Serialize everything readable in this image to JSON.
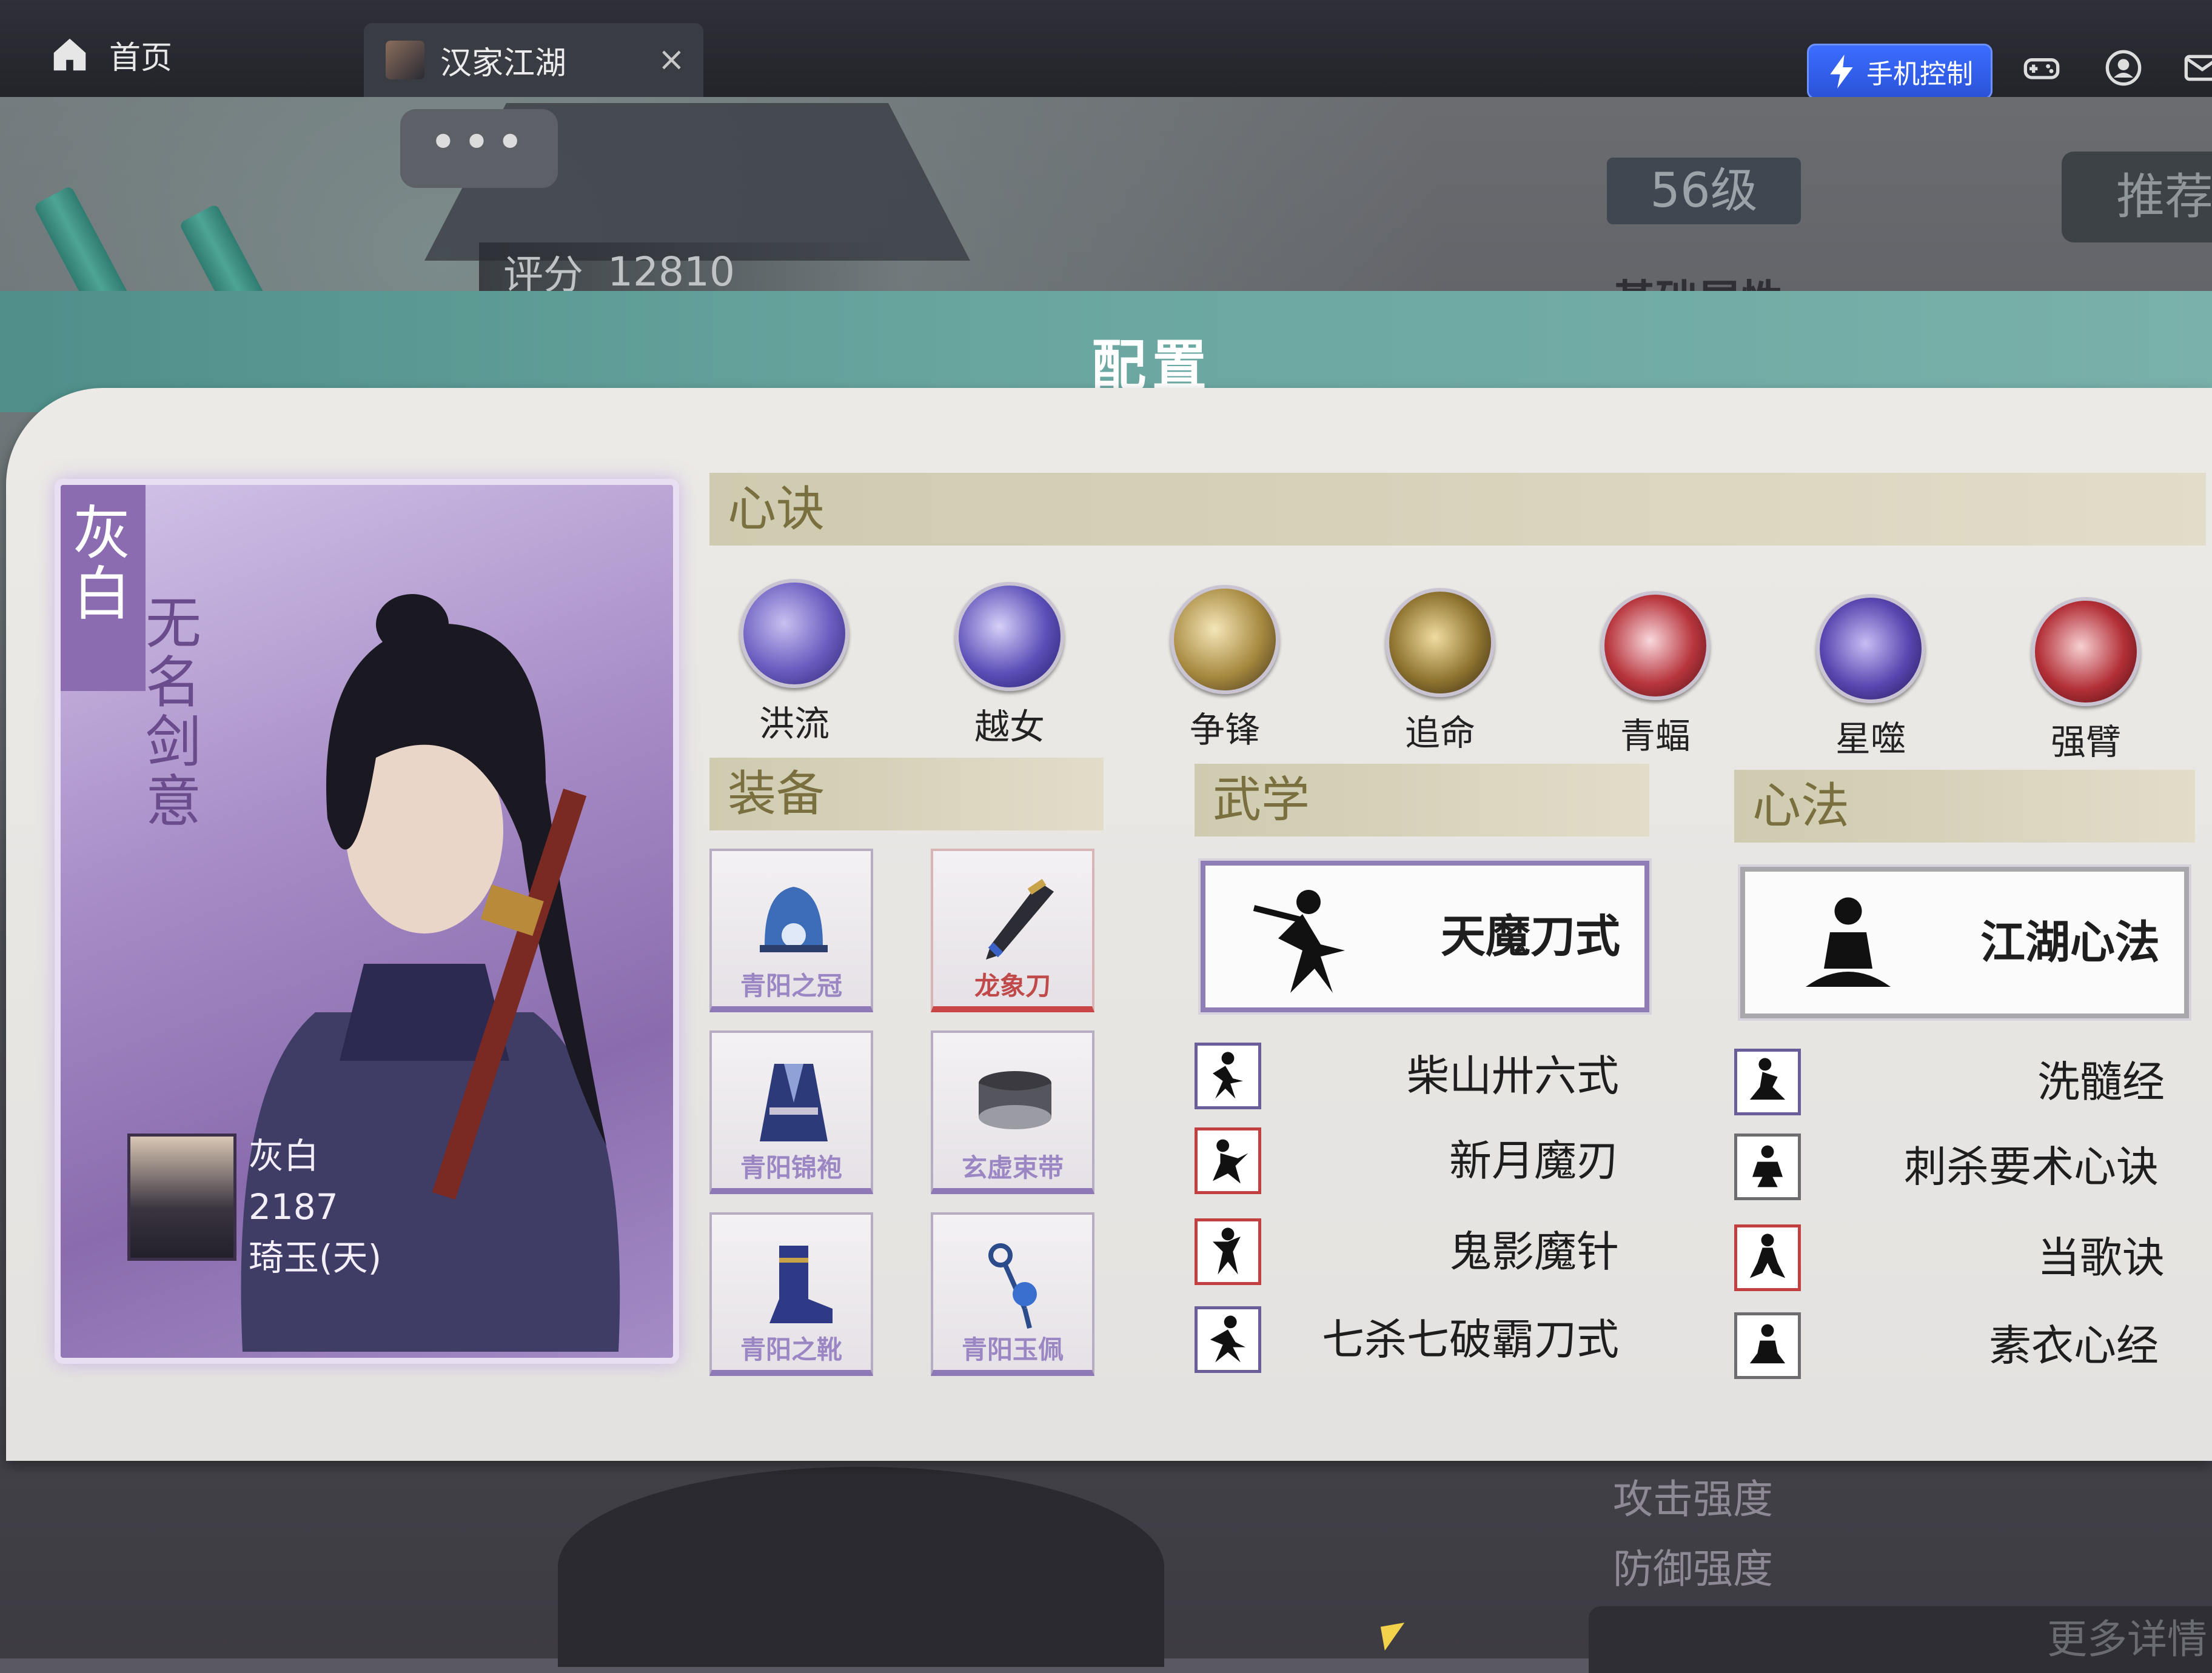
{
  "topbar": {
    "home_label": "首页",
    "game_tab_label": "汉家江湖",
    "close_glyph": "×",
    "phone_control_label": "手机控制",
    "icons": [
      "home-icon",
      "gamepad-icon",
      "user-icon",
      "mail-icon"
    ],
    "accent_color": "#2f5fe8"
  },
  "background": {
    "chat_dots": "•••",
    "score_label": "评分",
    "score_value": "12810",
    "level": "56级",
    "recommend_label": "推荐",
    "attributes_title": "基础属性",
    "attack_label": "攻击强度",
    "defense_label": "防御强度",
    "more_details_label": "更多详情"
  },
  "modal": {
    "title": "配置",
    "character": {
      "name_vertical": "灰白",
      "title_vertical": "无名剑意",
      "name": "灰白",
      "number": "2187",
      "server": "琦玉(天)"
    },
    "xinjue": {
      "header": "心诀",
      "skills": [
        {
          "label": "洪流",
          "color": "#6a5cc0"
        },
        {
          "label": "越女",
          "color": "#5c4fb8"
        },
        {
          "label": "争锋",
          "color": "#a7893f"
        },
        {
          "label": "追命",
          "color": "#8f7430"
        },
        {
          "label": "青蝠",
          "color": "#b8353d"
        },
        {
          "label": "星噬",
          "color": "#5a46b0"
        },
        {
          "label": "强臂",
          "color": "#b32f37"
        }
      ]
    },
    "equipment": {
      "header": "装备",
      "items": [
        {
          "label": "青阳之冠"
        },
        {
          "label": "龙象刀"
        },
        {
          "label": "青阳锦袍"
        },
        {
          "label": "玄虚束带"
        },
        {
          "label": "青阳之靴"
        },
        {
          "label": "青阳玉佩"
        }
      ]
    },
    "martial": {
      "header": "武学",
      "main": "天魔刀式",
      "list": [
        "柴山卅六式",
        "新月魔刃",
        "鬼影魔针",
        "七杀七破霸刀式"
      ]
    },
    "heart": {
      "header": "心法",
      "main": "江湖心法",
      "list": [
        "洗髓经",
        "刺杀要术心诀",
        "当歌诀",
        "素衣心经"
      ]
    }
  }
}
